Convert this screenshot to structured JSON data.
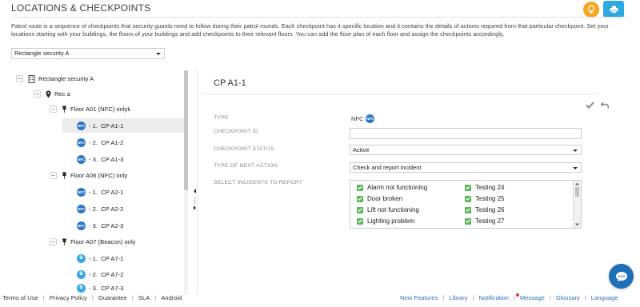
{
  "header": {
    "title": "LOCATIONS & CHECKPOINTS",
    "intro": "Patrol route is a sequence of checkpoints that security guards need to follow during their patrol rounds. Each checkpoint has it specific location and it contains the details of actions required from that particular checkpoint. Set your locations starting with your buildings, the floors of your buildings and add checkpoints to their relevant floors. You can add the floor plan of each floor and assign the checkpoints accordingly."
  },
  "location_select": {
    "value": "Rectangle security A"
  },
  "tree": {
    "root": "Rectangle security A",
    "site": "Rec a",
    "floors": [
      {
        "label": "Floor A01 (NFC) onlyk",
        "checkpoints": [
          {
            "prefix": "- 1.",
            "name": "CP A1-1",
            "badge": "NFC"
          },
          {
            "prefix": "- 2.",
            "name": "CP A1-2",
            "badge": "NFC"
          },
          {
            "prefix": "- 3.",
            "name": "CP A1-3",
            "badge": "NFC"
          }
        ]
      },
      {
        "label": "Floor A06 (NFC) only",
        "checkpoints": [
          {
            "prefix": "- 1.",
            "name": "CP A2-1",
            "badge": "NFC"
          },
          {
            "prefix": "- 2.",
            "name": "CP A2-2",
            "badge": "NFC"
          },
          {
            "prefix": "- 3.",
            "name": "CP A2-3",
            "badge": "NFC"
          }
        ]
      },
      {
        "label": "Floor A07 (Beacon) only",
        "checkpoints": [
          {
            "prefix": "- 1.",
            "name": "CP A7-1",
            "badge": "B"
          },
          {
            "prefix": "- 2.",
            "name": "CP A7-2",
            "badge": "B"
          },
          {
            "prefix": "- 3.",
            "name": "CP A7-3",
            "badge": "B"
          }
        ]
      }
    ]
  },
  "form": {
    "title": "CP A1-1",
    "type_label": "TYPE",
    "type_value": "NFC",
    "checkpoint_id_label": "CHECKPOINT ID",
    "checkpoint_id_value": "",
    "status_label": "CHECKPOINT STATUS",
    "status_value": "Active",
    "next_action_label": "TYPE OF NEXT ACTION",
    "next_action_value": "Check and report incident",
    "incidents_label": "SELECT INCIDENTS TO REPORT",
    "incidents_left": [
      "Alarm not functioning",
      "Door broken",
      "Lift not functioning",
      "Lighting problem"
    ],
    "incidents_right": [
      "Testing 24",
      "Testing 25",
      "Testing 26",
      "Testing 27"
    ]
  },
  "footer": {
    "left": [
      "Terms of Use",
      "Privacy Policy",
      "Guarantee",
      "SLA",
      "Android"
    ],
    "right": [
      "New Features",
      "Library",
      "Notification",
      "Message",
      "Glossary",
      "Language"
    ]
  },
  "colors": {
    "accent_blue": "#2da8e0",
    "bulb_orange": "#f5a623",
    "nfc_blue": "#2e77c6",
    "check_green": "#5bb75b",
    "link_blue": "#2e6fbd"
  }
}
